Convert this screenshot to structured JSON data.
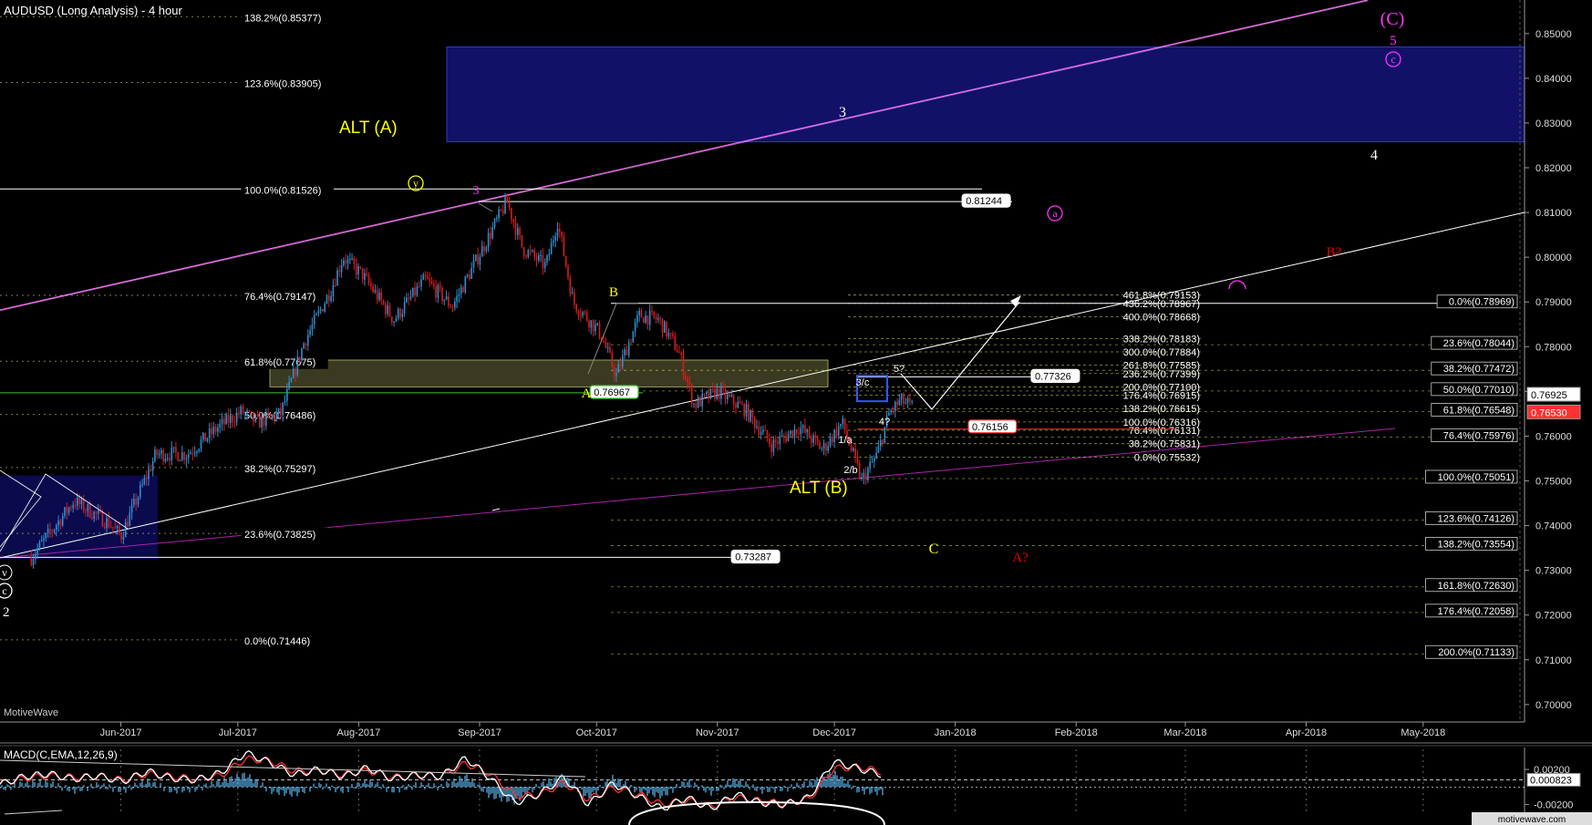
{
  "header": {
    "title": "AUDUSD (Long Analysis) - 4 hour",
    "watermark": "MotiveWave",
    "footer_brand": "motivewave.com"
  },
  "colors": {
    "background": "#000000",
    "axis": "#9a9a9a",
    "candle_up": "#2f8fd0",
    "candle_down": "#d81c1c",
    "fib_label_bg": "#ffffff",
    "yellow_label": "#ffff00",
    "magenta_label": "#ff33ff",
    "red_label": "#e00000",
    "blue_zone": "#14147a",
    "macd_line": "#ffffff",
    "signal_line": "#ff3030",
    "histogram": "#4fa0d0"
  },
  "chart_data": [
    {
      "type": "line",
      "subtype": "candlestick",
      "title": "AUDUSD (Long Analysis) - 4 hour",
      "x_axis_months": [
        "Jun-2017",
        "Jul-2017",
        "Aug-2017",
        "Sep-2017",
        "Oct-2017",
        "Nov-2017",
        "Dec-2017",
        "Jan-2018",
        "Feb-2018",
        "Mar-2018",
        "Apr-2018",
        "May-2018"
      ],
      "y_ticks": [
        "0.85000",
        "0.84000",
        "0.83000",
        "0.82000",
        "0.81000",
        "0.80000",
        "0.79000",
        "0.78000",
        "0.77000",
        "0.76000",
        "0.75000",
        "0.74000",
        "0.73000",
        "0.72000",
        "0.71000",
        "0.70000"
      ],
      "ylim": [
        0.6965,
        0.8575
      ],
      "current_price_labels": [
        "0.76925",
        "0.76530"
      ],
      "price_path": [
        {
          "x": "2017-05-09",
          "y": 0.7329
        },
        {
          "x": "2017-05-20",
          "y": 0.7455
        },
        {
          "x": "2017-05-29",
          "y": 0.7405
        },
        {
          "x": "2017-06-01",
          "y": 0.7376
        },
        {
          "x": "2017-06-10",
          "y": 0.756
        },
        {
          "x": "2017-06-18",
          "y": 0.756
        },
        {
          "x": "2017-06-26",
          "y": 0.762
        },
        {
          "x": "2017-07-02",
          "y": 0.7655
        },
        {
          "x": "2017-07-06",
          "y": 0.763
        },
        {
          "x": "2017-07-12",
          "y": 0.765
        },
        {
          "x": "2017-07-18",
          "y": 0.781
        },
        {
          "x": "2017-07-25",
          "y": 0.793
        },
        {
          "x": "2017-07-28",
          "y": 0.8
        },
        {
          "x": "2017-08-02",
          "y": 0.796
        },
        {
          "x": "2017-08-10",
          "y": 0.786
        },
        {
          "x": "2017-08-18",
          "y": 0.795
        },
        {
          "x": "2017-08-25",
          "y": 0.789
        },
        {
          "x": "2017-08-31",
          "y": 0.799
        },
        {
          "x": "2017-09-08",
          "y": 0.8125
        },
        {
          "x": "2017-09-12",
          "y": 0.802
        },
        {
          "x": "2017-09-18",
          "y": 0.798
        },
        {
          "x": "2017-09-21",
          "y": 0.808
        },
        {
          "x": "2017-09-25",
          "y": 0.79
        },
        {
          "x": "2017-10-02",
          "y": 0.783
        },
        {
          "x": "2017-10-06",
          "y": 0.7735
        },
        {
          "x": "2017-10-12",
          "y": 0.787
        },
        {
          "x": "2017-10-17",
          "y": 0.786
        },
        {
          "x": "2017-10-22",
          "y": 0.779
        },
        {
          "x": "2017-10-26",
          "y": 0.767
        },
        {
          "x": "2017-11-01",
          "y": 0.77
        },
        {
          "x": "2017-11-08",
          "y": 0.766
        },
        {
          "x": "2017-11-15",
          "y": 0.758
        },
        {
          "x": "2017-11-22",
          "y": 0.762
        },
        {
          "x": "2017-11-28",
          "y": 0.757
        },
        {
          "x": "2017-12-03",
          "y": 0.763
        },
        {
          "x": "2017-12-08",
          "y": 0.75
        },
        {
          "x": "2017-12-12",
          "y": 0.756
        },
        {
          "x": "2017-12-15",
          "y": 0.765
        },
        {
          "x": "2017-12-18",
          "y": 0.768
        },
        {
          "x": "2017-12-21",
          "y": 0.7665
        }
      ],
      "left_fib_levels": [
        {
          "label": "138.2%(0.85377)",
          "price": 0.85377
        },
        {
          "label": "123.6%(0.83905)",
          "price": 0.83905
        },
        {
          "label": "100.0%(0.81526)",
          "price": 0.81526
        },
        {
          "label": "76.4%(0.79147)",
          "price": 0.79147
        },
        {
          "label": "61.8%(0.77675)",
          "price": 0.77675
        },
        {
          "label": "50.0%(0.76486)",
          "price": 0.76486
        },
        {
          "label": "38.2%(0.75297)",
          "price": 0.75297
        },
        {
          "label": "23.6%(0.73825)",
          "price": 0.73825
        },
        {
          "label": "0.0%(0.71446)",
          "price": 0.71446
        }
      ],
      "mid_fib_levels": [
        {
          "label": "461.8%(0.79153)",
          "price": 0.79153
        },
        {
          "label": "436.2%(0.78967)",
          "price": 0.78967
        },
        {
          "label": "400.0%(0.78668)",
          "price": 0.78668
        },
        {
          "label": "338.2%(0.78183)",
          "price": 0.78183
        },
        {
          "label": "300.0%(0.77884)",
          "price": 0.77884
        },
        {
          "label": "261.8%(0.77585)",
          "price": 0.77585
        },
        {
          "label": "236.2%(0.77399)",
          "price": 0.77399
        },
        {
          "label": "200.0%(0.77100)",
          "price": 0.771
        },
        {
          "label": "176.4%(0.76915)",
          "price": 0.76915
        },
        {
          "label": "138.2%(0.76615)",
          "price": 0.76615
        },
        {
          "label": "100.0%(0.76316)",
          "price": 0.76316
        },
        {
          "label": "76.4%(0.76131)",
          "price": 0.76131
        },
        {
          "label": "38.2%(0.75831)",
          "price": 0.75831
        },
        {
          "label": "0.0%(0.75532)",
          "price": 0.75532
        }
      ],
      "right_fib_levels": [
        {
          "label": "0.0%(0.78969)",
          "price": 0.78969
        },
        {
          "label": "23.6%(0.78044)",
          "price": 0.78044
        },
        {
          "label": "38.2%(0.77472)",
          "price": 0.77472
        },
        {
          "label": "50.0%(0.77010)",
          "price": 0.7701
        },
        {
          "label": "61.8%(0.76548)",
          "price": 0.76548
        },
        {
          "label": "76.4%(0.75976)",
          "price": 0.75976
        },
        {
          "label": "100.0%(0.75051)",
          "price": 0.75051
        },
        {
          "label": "123.6%(0.74126)",
          "price": 0.74126
        },
        {
          "label": "138.2%(0.73554)",
          "price": 0.73554
        },
        {
          "label": "161.8%(0.72630)",
          "price": 0.7263
        },
        {
          "label": "176.4%(0.72058)",
          "price": 0.72058
        },
        {
          "label": "200.0%(0.71133)",
          "price": 0.71133
        }
      ],
      "price_tags": [
        "0.81244",
        "0.76967",
        "0.77326",
        "0.76156",
        "0.73287"
      ],
      "wave_labels": {
        "alt_a": "ALT (A)",
        "alt_b": "ALT (B)",
        "big_c": "(C)",
        "five": "5",
        "c_circle": "c",
        "a_circle": "a",
        "three_white": "3",
        "four_white": "4",
        "three_magenta": "3",
        "y_circle": "y",
        "b_yellow": "B",
        "a_yellow": "A",
        "c_yellow": "C",
        "b_red": "B?",
        "a_red": "A?",
        "five_q": "5?",
        "four_q": "4?",
        "three_c": "3/c",
        "one_a": "1/a",
        "two_b": "2/b",
        "left_y": "v",
        "left_c": "c",
        "left_2": "2"
      }
    },
    {
      "type": "line",
      "title": "MACD(C,EMA,12,26,9)",
      "y_ticks": [
        "0.00200",
        "0.000823",
        "-0.00200"
      ],
      "ylim": [
        -0.0035,
        0.0045
      ],
      "current_value": 0.000823,
      "series": [
        {
          "name": "MACD",
          "values": [
            0.0003,
            0.0012,
            0.0015,
            0.0009,
            0.0013,
            0.0006,
            0.0018,
            0.001,
            0.0008,
            0.0016,
            0.0039,
            0.0028,
            0.0014,
            0.002,
            0.0012,
            0.0022,
            0.0009,
            0.0014,
            0.0012,
            0.0033,
            0.001,
            -0.0018,
            -0.0008,
            0.0011,
            -0.002,
            0.0004,
            -0.001,
            -0.0025,
            -0.0012,
            -0.0025,
            -0.0008,
            -0.0018,
            -0.002,
            -0.0012,
            0.0029,
            0.0021,
            0.0014
          ]
        },
        {
          "name": "Signal",
          "values": [
            0.0004,
            0.001,
            0.0013,
            0.0011,
            0.0012,
            0.0008,
            0.0015,
            0.0012,
            0.0009,
            0.0013,
            0.0032,
            0.003,
            0.0018,
            0.0019,
            0.0014,
            0.0019,
            0.0011,
            0.0013,
            0.0012,
            0.0027,
            0.0015,
            -0.001,
            -0.0009,
            0.0005,
            -0.0014,
            -0.0001,
            -0.0008,
            -0.002,
            -0.0015,
            -0.0022,
            -0.0012,
            -0.0016,
            -0.0019,
            -0.0014,
            0.0021,
            0.0023,
            0.0017
          ]
        }
      ]
    }
  ]
}
